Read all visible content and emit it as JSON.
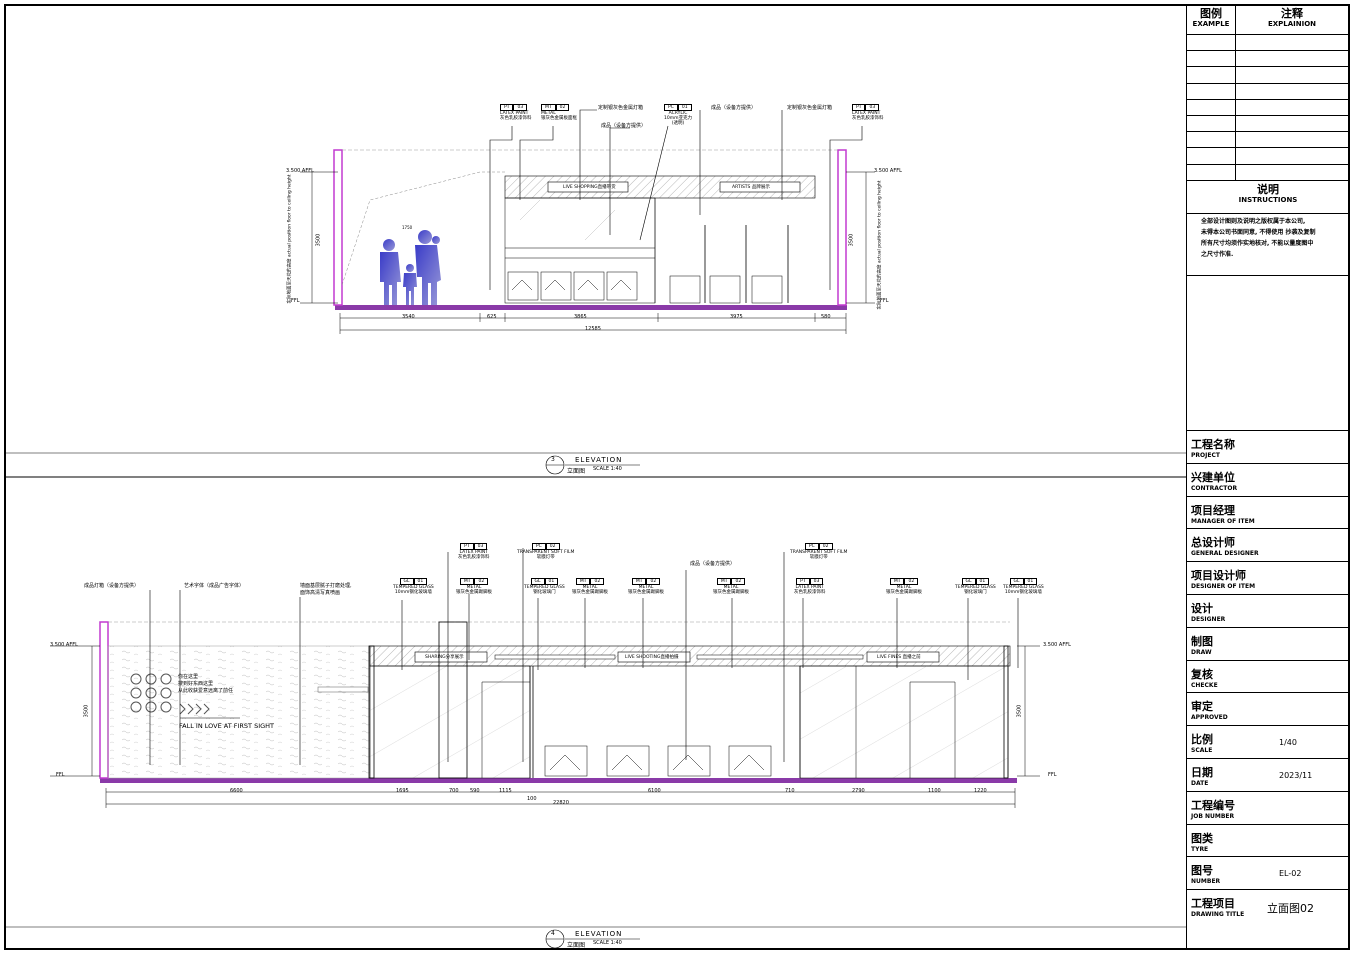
{
  "legend": {
    "example_cn": "图例",
    "example_en": "EXAMPLE",
    "explain_cn": "注释",
    "explain_en": "EXPLAINION"
  },
  "instructions": {
    "title_cn": "说明",
    "title_en": "INSTRUCTIONS",
    "lines": [
      "全部设计图则及说明之版权属于本公司,",
      "未得本公司书面同意, 不得使用 抄袭及复制",
      "所有尺寸均须作实地核对, 不能以量度图中",
      "之尺寸作准."
    ]
  },
  "title_block": [
    {
      "cn": "工程名称",
      "en": "PROJECT",
      "value": ""
    },
    {
      "cn": "兴建单位",
      "en": "CONTRACTOR",
      "value": ""
    },
    {
      "cn": "项目经理",
      "en": "MANAGER OF ITEM",
      "value": ""
    },
    {
      "cn": "总设计师",
      "en": "GENERAL DESIGNER",
      "value": ""
    },
    {
      "cn": "项目设计师",
      "en": "DESIGNER OF ITEM",
      "value": ""
    },
    {
      "cn": "设计",
      "en": "DESIGNER",
      "value": ""
    },
    {
      "cn": "制图",
      "en": "DRAW",
      "value": ""
    },
    {
      "cn": "复核",
      "en": "CHECKE",
      "value": ""
    },
    {
      "cn": "审定",
      "en": "APPROVED",
      "value": ""
    },
    {
      "cn": "比例",
      "en": "SCALE",
      "value": "1/40"
    },
    {
      "cn": "日期",
      "en": "DATE",
      "value": "2023/11"
    },
    {
      "cn": "工程编号",
      "en": "JOB NUMBER",
      "value": ""
    },
    {
      "cn": "图类",
      "en": "TYRE",
      "value": ""
    },
    {
      "cn": "图号",
      "en": "NUMBER",
      "value": "EL-02"
    },
    {
      "cn": "工程项目",
      "en": "DRAWING TITLE",
      "value": "立面图02"
    }
  ],
  "elevation3": {
    "number": "3",
    "title": "ELEVATION",
    "subtitle_cn": "立面图",
    "scale": "SCALE 1:40",
    "level_top": "3.500 AFFL",
    "level_floor": "FFL",
    "dims": [
      "3540",
      "625",
      "3865",
      "3975",
      "580"
    ],
    "total": "12585",
    "height": "3500",
    "side_note": "实际地面至天花的高度 actual position floor to ceiling height",
    "tags": [
      {
        "code": "PT",
        "num": "03",
        "l1": "LATEX PAINT",
        "l2": "灰色乳胶漆饰料"
      },
      {
        "code": "MT",
        "num": "02",
        "l1": "METAL",
        "l2": "银灰色金属板面框"
      },
      {
        "code": "PC",
        "num": "01",
        "l1": "ACRYLIC",
        "l2": "10mm亚克力",
        "l3": "(透明)"
      },
      {
        "code": "PT",
        "num": "03",
        "l1": "LATEX PAINT",
        "l2": "灰色乳胶漆饰料"
      }
    ],
    "callouts": [
      "定制银灰色金属灯箱",
      "成品（设备方提供）",
      "成品（设备方提供）",
      "定制银灰色金属灯箱"
    ],
    "sign1": "LIVE SHOPPING直播带货",
    "sign2": "ARTISTS   品牌展示"
  },
  "elevation4": {
    "number": "4",
    "title": "ELEVATION",
    "subtitle_cn": "立面图",
    "scale": "SCALE 1:40",
    "level_top": "3.500 AFFL",
    "level_floor": "FFL",
    "dims": [
      "6600",
      "1695",
      "700",
      "590",
      "1115",
      "6100",
      "710",
      "2790",
      "1100",
      "1220"
    ],
    "sub_dim": "100",
    "total": "22820",
    "height": "3500",
    "slogan": "FALL IN LOVE AT FIRST SIGHT",
    "wall_text": [
      "你在这里",
      "搜到好东西这里",
      "从此收获爱意远离了前任"
    ],
    "callouts": [
      "成品灯箱（设备方提供）",
      "艺术字体（成品广告字体）",
      "墙面基层腻子打磨处理,",
      "面饰高清写真喷画",
      "成品（设备方提供）"
    ],
    "tags": [
      {
        "code": "GL",
        "num": "01",
        "l1": "TEMPERED GLASS",
        "l2": "10mm钢化玻璃墙"
      },
      {
        "code": "MT",
        "num": "02",
        "l1": "METAL",
        "l2": "银灰色金属踢脚板"
      },
      {
        "code": "PT",
        "num": "03",
        "l1": "LATEX PAINT",
        "l2": "灰色乳胶漆饰料"
      },
      {
        "code": "PC",
        "num": "02",
        "l1": "TRANSPARENT SOFT FILM",
        "l2": "软膜灯带"
      },
      {
        "code": "GL",
        "num": "01",
        "l1": "TEMPERED GLASS",
        "l2": "钢化玻璃门"
      },
      {
        "code": "MT",
        "num": "02",
        "l1": "METAL",
        "l2": "银灰色金属踢脚板"
      },
      {
        "code": "MT",
        "num": "02",
        "l1": "METAL",
        "l2": "银灰色金属踢脚板"
      },
      {
        "code": "MT",
        "num": "02",
        "l1": "METAL",
        "l2": "银灰色金属踢脚板"
      },
      {
        "code": "PC",
        "num": "02",
        "l1": "TRANSPARENT SOFT FILM",
        "l2": "软膜灯带"
      },
      {
        "code": "PT",
        "num": "03",
        "l1": "LATEX PAINT",
        "l2": "灰色乳胶漆饰料"
      },
      {
        "code": "MT",
        "num": "02",
        "l1": "METAL",
        "l2": "银灰色金属踢脚板"
      },
      {
        "code": "GL",
        "num": "01",
        "l1": "TEMPERED GLASS",
        "l2": "钢化玻璃门"
      },
      {
        "code": "GL",
        "num": "01",
        "l1": "TEMPERED GLASS",
        "l2": "10mm钢化玻璃墙"
      }
    ],
    "signs": [
      "SHARING分享展示",
      "LIVE SHOOTING直播拍摄",
      "LIVE FINES 直播之前"
    ]
  }
}
